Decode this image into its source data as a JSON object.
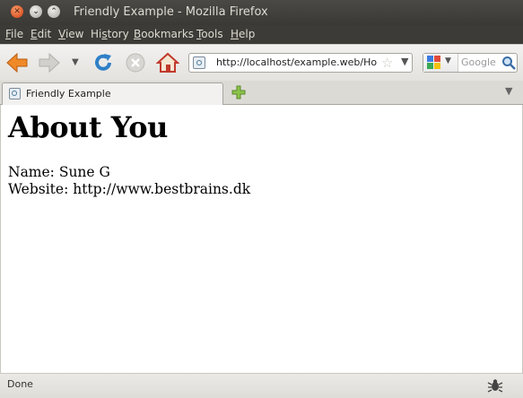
{
  "window": {
    "title": "Friendly Example - Mozilla Firefox"
  },
  "menu": {
    "items": [
      {
        "label": "File",
        "accel": "F",
        "rest": "ile"
      },
      {
        "label": "Edit",
        "accel": "E",
        "rest": "dit"
      },
      {
        "label": "View",
        "accel": "V",
        "rest": "iew"
      },
      {
        "label": "History",
        "pre": "Hi",
        "accel": "s",
        "rest": "tory"
      },
      {
        "label": "Bookmarks",
        "accel": "B",
        "rest": "ookmarks"
      },
      {
        "label": "Tools",
        "accel": "T",
        "rest": "ools"
      },
      {
        "label": "Help",
        "accel": "H",
        "rest": "elp"
      }
    ]
  },
  "navbar": {
    "url": "http://localhost/example.web/Ho",
    "search_placeholder": "Google"
  },
  "tabs": [
    {
      "label": "Friendly Example",
      "active": true
    }
  ],
  "page": {
    "heading": "About You",
    "name_line": "Name: Sune G",
    "website_line": "Website: http://www.bestbrains.dk"
  },
  "status": {
    "text": "Done"
  },
  "colors": {
    "titlebar": "#3c3b37",
    "close_button": "#e0582a",
    "chrome": "#f2f1f0",
    "content_bg": "#ffffff"
  }
}
